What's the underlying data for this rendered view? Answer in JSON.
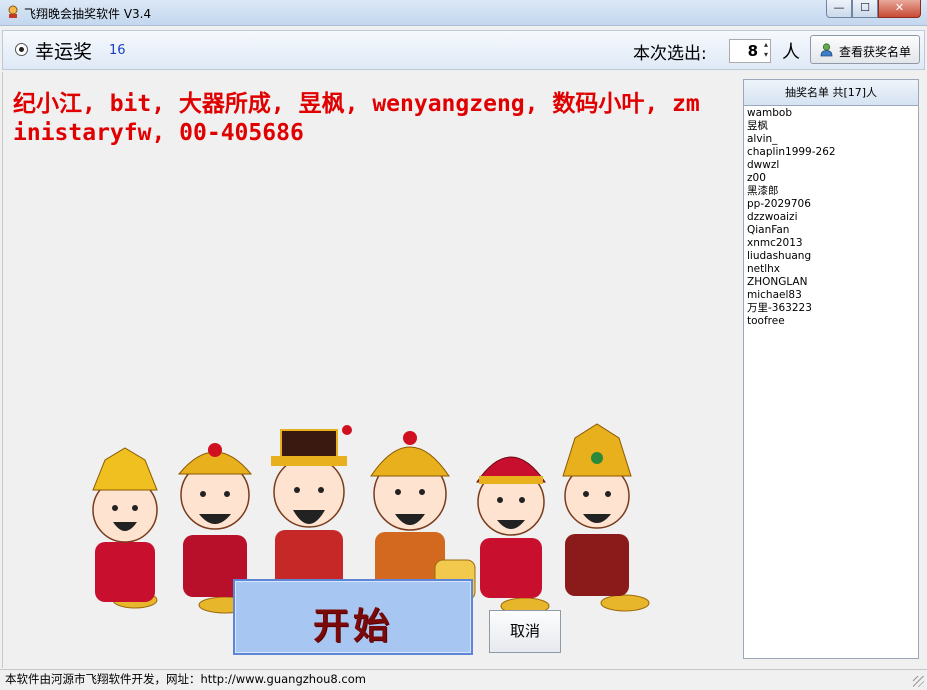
{
  "window": {
    "title": "飞翔晚会抽奖软件 V3.4",
    "min_glyph": "—",
    "max_glyph": "☐",
    "close_glyph": "✕"
  },
  "toolbar": {
    "prize_name": "幸运奖",
    "prize_count": "16",
    "select_label": "本次选出:",
    "select_value": "8",
    "person_label": "人",
    "view_winners_label": "查看获奖名单"
  },
  "main": {
    "winners_text": "纪小江, bit, 大器所成, 昱枫, wenyangzeng, 数码小叶, zministaryfw, 00-405686",
    "start_label": "开始",
    "cancel_label": "取消"
  },
  "list": {
    "header": "抽奖名单 共[17]人",
    "items": [
      "wambob",
      "昱枫",
      "alvin_",
      "chaplin1999-262",
      "dwwzl",
      "z00",
      "黑漆郎",
      "pp-2029706",
      "dzzwoaizi",
      "QianFan",
      "xnmc2013",
      "liudashuang",
      "netlhx",
      "ZHONGLAN",
      "michael83",
      "万里-363223",
      "toofree"
    ]
  },
  "status": {
    "text": "本软件由河源市飞翔软件开发，网址：http://www.guangzhou8.com"
  },
  "colors": {
    "winner_text": "#e00000",
    "start_button_bg": "#a7c6f2",
    "start_label": "#7a0a0a"
  }
}
